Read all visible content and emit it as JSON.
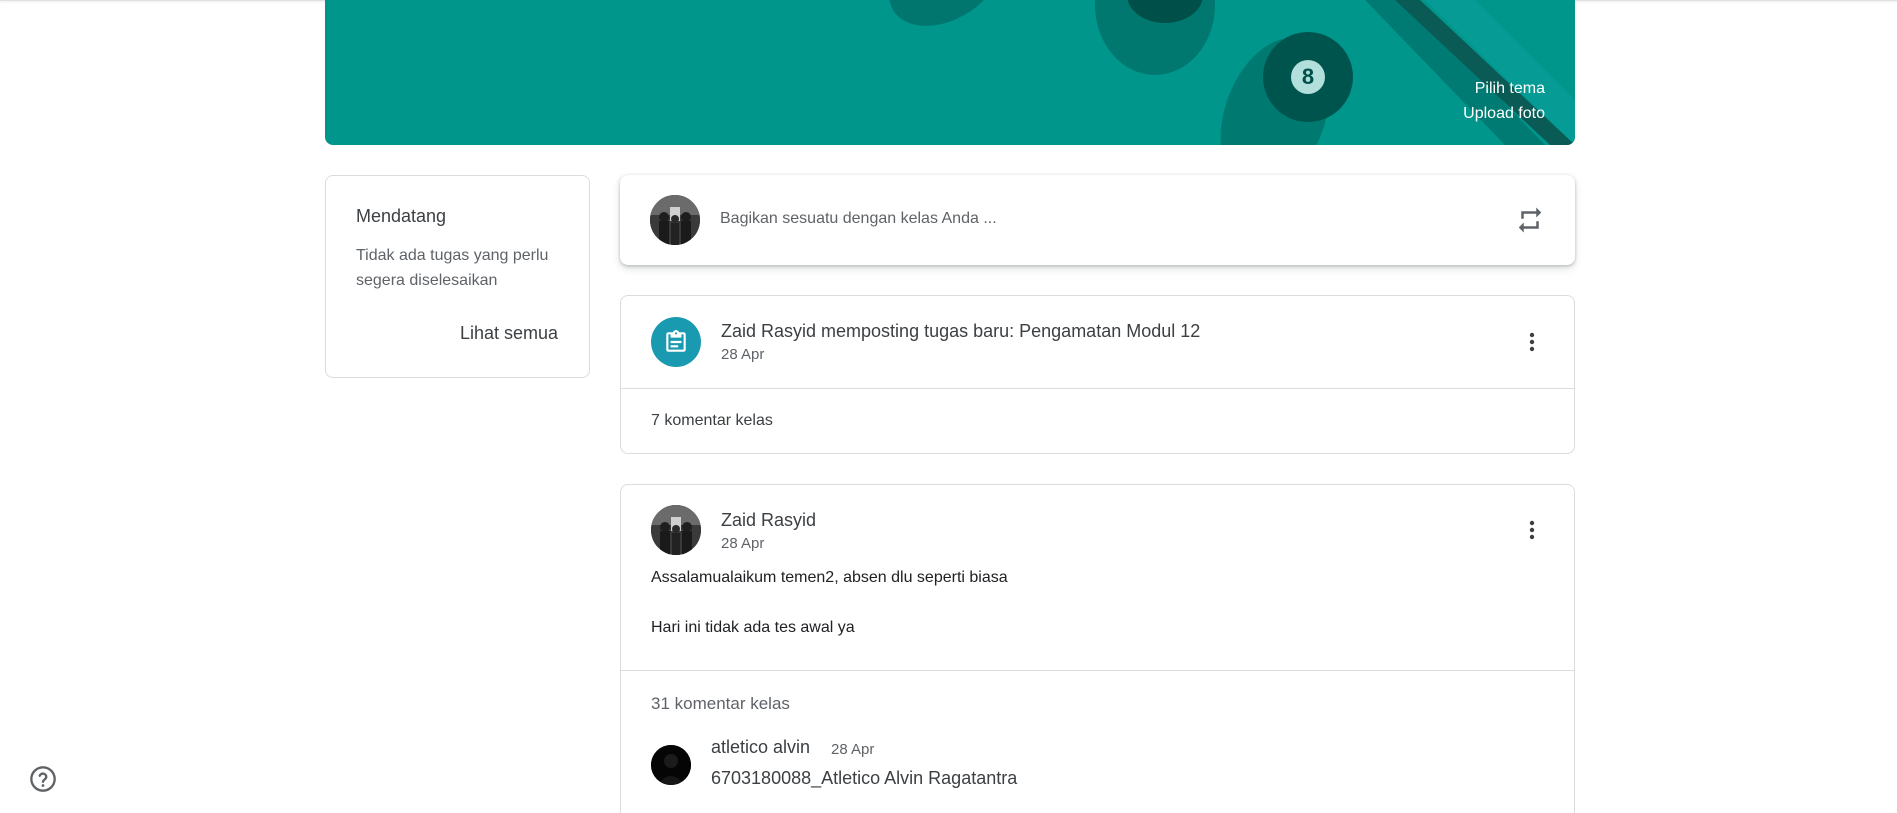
{
  "banner": {
    "badge_number": "8",
    "select_theme": "Pilih tema",
    "upload_photo": "Upload foto",
    "color": "#00968c"
  },
  "upcoming": {
    "title": "Mendatang",
    "empty_text": "Tidak ada tugas yang perlu segera diselesaikan",
    "view_all": "Lihat semua"
  },
  "share": {
    "placeholder": "Bagikan sesuatu dengan kelas Anda ..."
  },
  "posts": [
    {
      "title": "Zaid Rasyid memposting tugas baru: Pengamatan Modul 12",
      "date": "28 Apr",
      "comments": "7 komentar kelas",
      "icon_color": "#1a9ab0"
    },
    {
      "author": "Zaid Rasyid",
      "date": "28 Apr",
      "body_line1": "Assalamualaikum temen2, absen dlu seperti biasa",
      "body_line2": "Hari ini tidak ada tes awal ya",
      "comments": "31 komentar kelas",
      "comment": {
        "author": "atletico alvin",
        "date": "28 Apr",
        "text": "6703180088_Atletico Alvin Ragatantra"
      }
    }
  ]
}
